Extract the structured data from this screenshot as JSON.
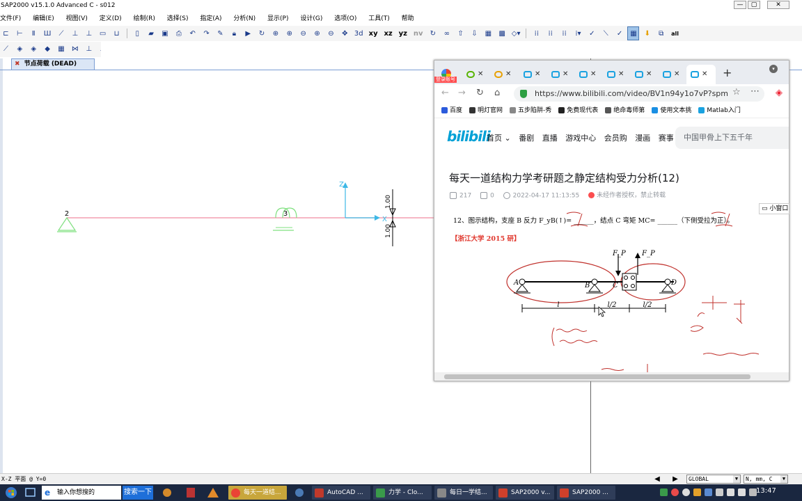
{
  "app": {
    "title": "SAP2000 v15.1.0 Advanced C  - s012",
    "min": "—",
    "restore": "▢",
    "close": "✕"
  },
  "menu": [
    "文件(F)",
    "编辑(E)",
    "视图(V)",
    "定义(D)",
    "绘制(R)",
    "选择(S)",
    "指定(A)",
    "分析(N)",
    "显示(P)",
    "设计(G)",
    "选项(O)",
    "工具(T)",
    "帮助"
  ],
  "toolbar": {
    "xy": "xy",
    "xz": "xz",
    "yz": "yz",
    "nv": "nv",
    "all": "all"
  },
  "view": {
    "tab_label": "节点荷载 (DEAD)",
    "joint_2": "2",
    "joint_3": "3",
    "axis_z": "Z",
    "axis_x": "X",
    "load_top": "1.00",
    "load_bottom": "1.00"
  },
  "browser": {
    "login_badge": "登录账号",
    "tab_count": 9,
    "url": "https://www.bilibili.com/video/BV1n94y1o7vP?spm",
    "bookmarks": [
      {
        "label": "百度",
        "color": "#2b5bdc"
      },
      {
        "label": "明灯官网",
        "color": "#333333"
      },
      {
        "label": "五步陷阱-秀",
        "color": "#888888"
      },
      {
        "label": "免费现代表",
        "color": "#222222"
      },
      {
        "label": "绝命毒师第",
        "color": "#555555"
      },
      {
        "label": "使用文本挑",
        "color": "#1a8fe3"
      },
      {
        "label": "Matlab入门",
        "color": "#1aa2e0"
      }
    ],
    "bili": {
      "logo": "bilibili",
      "nav": [
        "首页 ⌄",
        "番剧",
        "直播",
        "游戏中心",
        "会员购",
        "漫画",
        "赛事"
      ],
      "search_placeholder": "中国甲骨上下五千年",
      "video_title": "每天一道结构力学考研题之静定结构受力分析(12)",
      "views": "217",
      "danmaku": "0",
      "date": "2022-04-17 11:13:55",
      "repost": "未经作者授权，禁止转载"
    },
    "problem": {
      "question": "12、图示结构，支座 B 反力 F_yB(↑)= ______，结点 C 弯矩 MC= ______（下侧受拉为正）。",
      "source": "【浙江大学 2015 研】",
      "fp_left": "F_P",
      "fp_right": "F_P",
      "label_a": "A",
      "label_b": "B",
      "label_c": "C",
      "label_d": "D",
      "dim_l": "l",
      "dim_l2a": "l/2",
      "dim_l2b": "l/2"
    }
  },
  "miniwindow": "小窗口",
  "status": {
    "plane": "X-Z 平面 @ Y=0",
    "coord": "GLOBAL",
    "units": "N, mm, C"
  },
  "taskbar": {
    "search_placeholder": "输入你想搜的",
    "search_button": "搜索一下",
    "tasks": [
      {
        "label": "每天一道结...",
        "color": "#ea4335"
      },
      {
        "label": "AutoCAD ...",
        "color": "#c0392b"
      },
      {
        "label": "力学 - Clo...",
        "color": "#3a9a4a"
      },
      {
        "label": "每日一学结...",
        "color": "#666666"
      },
      {
        "label": "SAP2000 v...",
        "color": "#d0402b"
      },
      {
        "label": "SAP2000 ...",
        "color": "#d0402b"
      }
    ],
    "clock": "13:47"
  }
}
